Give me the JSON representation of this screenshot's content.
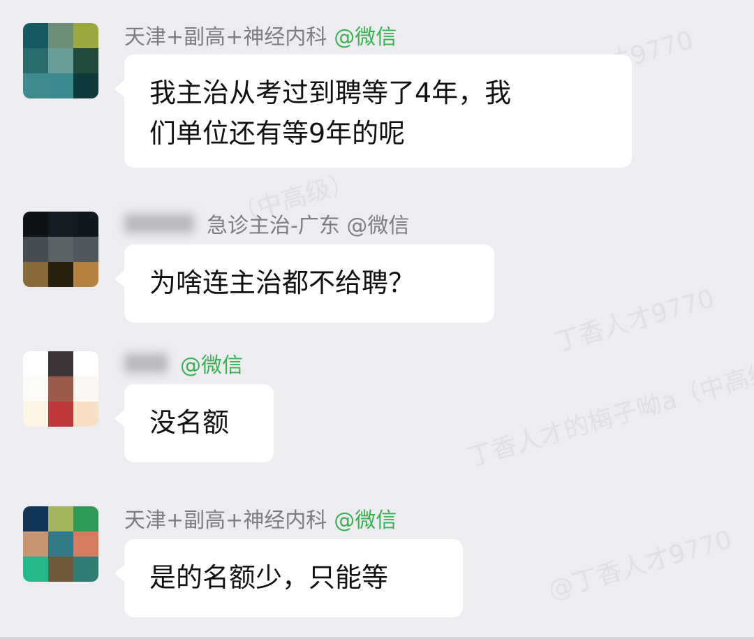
{
  "messages": [
    {
      "name": "天津+副高+神经内科",
      "channel": "@微信",
      "name_blurred": false,
      "text_lines": [
        "我主治从考过到聘等了4年，我",
        "们单位还有等9年的呢"
      ],
      "avatar_colors": [
        "#165a5f",
        "#6e8d77",
        "#9aa83d",
        "#2a6b6f",
        "#6a9e9a",
        "#1f4a3c",
        "#3f8a8d",
        "#3a8a8f",
        "#0e3a3c"
      ]
    },
    {
      "name": "",
      "channel": "急诊主治-广东 @微信",
      "name_blurred": true,
      "text_lines": [
        "为啥连主治都不给聘？"
      ],
      "avatar_colors": [
        "#0f1215",
        "#141b22",
        "#121820",
        "#454d52",
        "#5a6266",
        "#4e575b",
        "#8b6a3a",
        "#2a2010",
        "#b5823f"
      ]
    },
    {
      "name": "",
      "channel": "@微信",
      "name_blurred": true,
      "text_lines": [
        "没名额"
      ],
      "avatar_colors": [
        "#ffffff",
        "#3c3436",
        "#ffffff",
        "#fdfbf8",
        "#9b5d4a",
        "#fbf8f4",
        "#fdf4e4",
        "#c0393a",
        "#f9e0c4"
      ]
    },
    {
      "name": "天津+副高+神经内科",
      "channel": "@微信",
      "name_blurred": false,
      "text_lines": [
        "是的名额少，只能等"
      ],
      "avatar_colors": [
        "#0f3658",
        "#a4b65a",
        "#2f9a55",
        "#c79572",
        "#2f7b89",
        "#d57c60",
        "#25b888",
        "#6d5a3a",
        "#2f7d73"
      ]
    }
  ],
  "watermarks": [
    "丁香人才9770",
    "丁香人才的梅子呦a（中高级）",
    "@丁香人才9770",
    "（中高级）",
    "丁香人才的梅子呦)@丁香人才9770"
  ]
}
